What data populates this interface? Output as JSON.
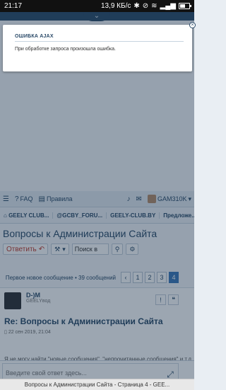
{
  "status": {
    "time": "21:17",
    "speed": "13,9 КБ/с",
    "battery_pct": 60
  },
  "topband": {
    "toggle_glyph": "⌄"
  },
  "modal": {
    "title": "ОШИБКА AJAX",
    "message": "При обработке запроса произошла ошибка.",
    "close_glyph": "×"
  },
  "nav": {
    "faq": "FAQ",
    "rules": "Правила",
    "username": "GAM310K",
    "caret": "▾"
  },
  "breadcrumbs": [
    "GEELY CLUB...",
    "@GCBY_FORU...",
    "GEELY-CLUB.BY",
    "Предложе..."
  ],
  "page_title": "Вопросы к Администрации Сайта",
  "toolbar": {
    "reply_label": "Ответить",
    "search_placeholder": "Поиск в",
    "caret": "▾"
  },
  "pagination": {
    "first_new": "Первое новое сообщение",
    "count": " • 39 сообщений",
    "pages": [
      "1",
      "2",
      "3",
      "4"
    ],
    "current": "4",
    "prev_glyph": "‹"
  },
  "post": {
    "author": "D-)M",
    "rank": "GEELYвод",
    "title": "Re: Вопросы к Администрации Сайта",
    "date": "22 сен 2019, 21:04",
    "body_excerpt": "Я не могу найти \"новые сообщения\", \"непрочитанные сообщения\" и т.д."
  },
  "reply_box": {
    "placeholder": "Введите свой ответ здесь..."
  },
  "browser": {
    "tab_title": "Вопросы к Администрации Сайта - Страница 4 - GEE..."
  },
  "colors": {
    "accent": "#2a4a68",
    "reply_red": "#c0392b",
    "page_active": "#3b78b8"
  }
}
